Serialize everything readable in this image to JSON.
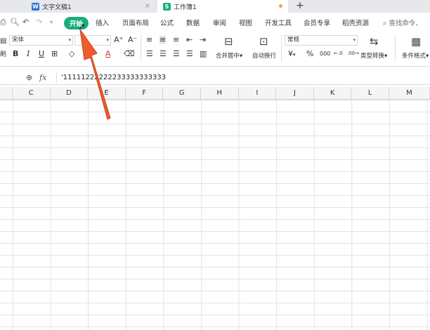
{
  "tabs": [
    {
      "label": "文字文稿1",
      "icon": "W",
      "color": "#2f6fd6"
    },
    {
      "label": "工作簿1",
      "icon": "S",
      "color": "#1aad7c"
    }
  ],
  "new_tab_symbol": "+",
  "close_symbol": "×",
  "menu": [
    "开始",
    "插入",
    "页面布局",
    "公式",
    "数据",
    "审阅",
    "视图",
    "开发工具",
    "会员专享",
    "稻壳资源"
  ],
  "search_label": "查找命令、",
  "ribbon": {
    "font_name": "宋体",
    "font_size": "",
    "number_format": "常规",
    "merge_label": "合并居中",
    "wrap_label": "自动换行",
    "convert_label": "类型转换",
    "cond_format_label": "条件格式",
    "currency": "¥",
    "percent": "%",
    "thousands": "000",
    "bold": "B",
    "italic": "I",
    "underline": "U",
    "font_color_glyph": "A"
  },
  "formula": {
    "fx": "fx",
    "value": "'11111222222233333333333"
  },
  "columns": [
    "C",
    "D",
    "E",
    "F",
    "G",
    "H",
    "I",
    "J",
    "K",
    "L",
    "M"
  ],
  "accent_color": "#1aad7c",
  "arrow_color": "#ee5b2e"
}
